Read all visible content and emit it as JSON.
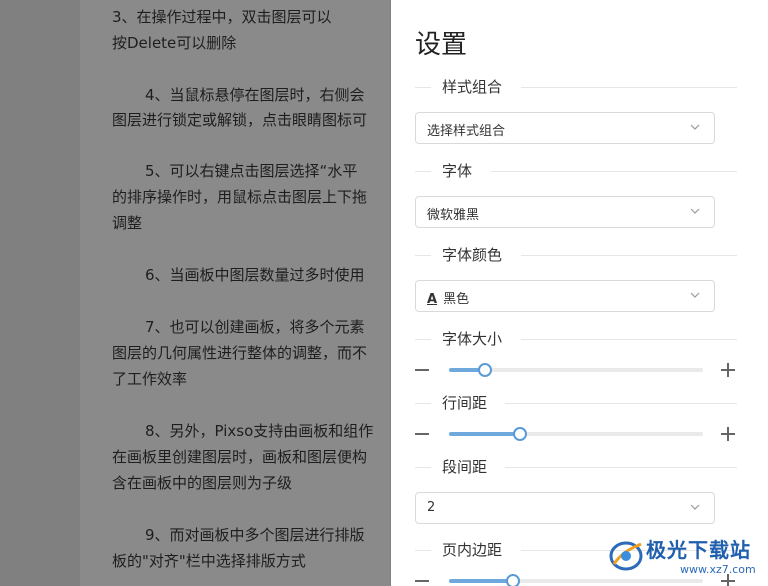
{
  "document": {
    "lines": [
      "3、在操作过程中，双击图层可以",
      "按Delete可以删除",
      "4、当鼠标悬停在图层时，右侧会",
      "图层进行锁定或解锁，点击眼睛图标可",
      "5、可以右键点击图层选择“水平",
      "的排序操作时，用鼠标点击图层上下拖",
      "调整",
      "6、当画板中图层数量过多时使用",
      "7、也可以创建画板，将多个元素",
      "图层的几何属性进行整体的调整，而不",
      "了工作效率",
      "8、另外，Pixso支持由画板和组作",
      "在画板里创建图层时，画板和图层便构",
      "含在画板中的图层则为子级",
      "9、而对画板中多个图层进行排版",
      "板的\"对齐\"栏中选择排版方式"
    ]
  },
  "panel": {
    "title": "设置",
    "style_group": {
      "label": "样式组合",
      "value": "选择样式组合"
    },
    "font": {
      "label": "字体",
      "value": "微软雅黑"
    },
    "font_color": {
      "label": "字体颜色",
      "icon_letter": "A",
      "value": "黑色"
    },
    "font_size": {
      "label": "字体大小",
      "level": 0.14
    },
    "line_spacing": {
      "label": "行间距",
      "level": 0.28
    },
    "para_spacing": {
      "label": "段间距",
      "value": "2"
    },
    "page_padding": {
      "label": "页内边距",
      "level": 0.25
    }
  },
  "watermark": {
    "text": "极光下载站",
    "sub": "www.xz7.com"
  },
  "colors": {
    "accent": "#5b9bd5",
    "overlay": "#808080"
  }
}
